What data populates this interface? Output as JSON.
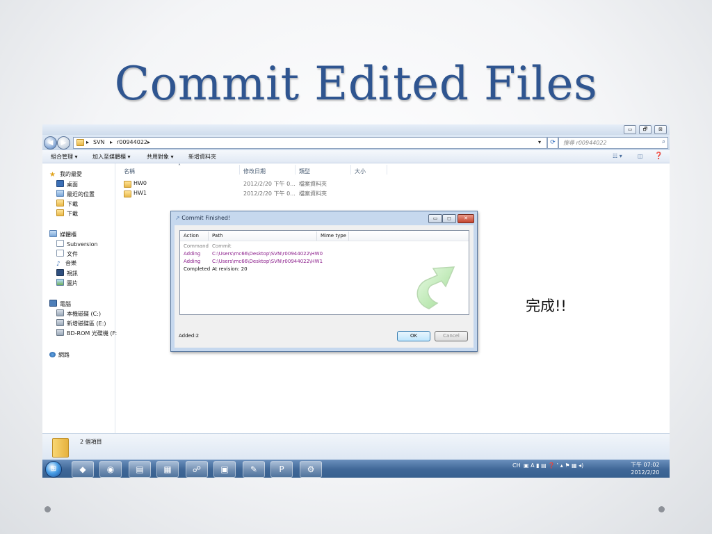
{
  "slide": {
    "title": "Commit Edited Files",
    "note": "完成!!"
  },
  "window": {
    "controls": [
      "▭",
      "🗗",
      "⊠"
    ],
    "breadcrumb": [
      "SVN",
      "r00944022"
    ],
    "search_placeholder": "搜尋 r00944022",
    "toolbar": [
      "組合管理 ▾",
      "加入至媒體櫃 ▾",
      "共用對象 ▾",
      "新增資料夾"
    ],
    "nav": {
      "favorites": {
        "label": "我的最愛",
        "items": [
          "桌面",
          "最近的位置",
          "下載",
          "下載"
        ]
      },
      "libraries": {
        "label": "媒體櫃",
        "items": [
          "Subversion",
          "文件",
          "音樂",
          "視訊",
          "圖片"
        ]
      },
      "computer": {
        "label": "電腦",
        "items": [
          "本機磁碟 (C:)",
          "新增磁碟區 (E:)",
          "BD-ROM 光碟機 (F:"
        ]
      },
      "network": {
        "label": "網路"
      }
    },
    "columns": [
      "名稱",
      "修改日期",
      "類型",
      "大小"
    ],
    "files": [
      {
        "name": "HW0",
        "date": "2012/2/20 下午 0...",
        "type": "檔案資料夾"
      },
      {
        "name": "HW1",
        "date": "2012/2/20 下午 0...",
        "type": "檔案資料夾"
      }
    ],
    "status": "2 個項目"
  },
  "dialog": {
    "title": "Commit Finished!",
    "columns": [
      "Action",
      "Path",
      "Mime type"
    ],
    "rows": [
      {
        "action": "Command",
        "path": "Commit",
        "color": "#808080"
      },
      {
        "action": "Adding",
        "path": "C:\\Users\\mc66\\Desktop\\SVN\\r00944022\\HW0",
        "color": "#8b1d8b"
      },
      {
        "action": "Adding",
        "path": "C:\\Users\\mc66\\Desktop\\SVN\\r00944022\\HW1",
        "color": "#8b1d8b"
      },
      {
        "action": "Completed",
        "path": "At revision: 20",
        "color": "#111111"
      }
    ],
    "summary": "Added:2",
    "ok": "OK",
    "cancel": "Cancel"
  },
  "taskbar": {
    "apps": [
      "Google Picasa",
      "Firefox",
      "Windows Explorer",
      "Task Manager",
      "Network",
      "Remote Desktop",
      "Paint",
      "PowerPoint",
      "Network Tool"
    ],
    "tray": "CH",
    "time": "下午 07:02",
    "date": "2012/2/20"
  }
}
